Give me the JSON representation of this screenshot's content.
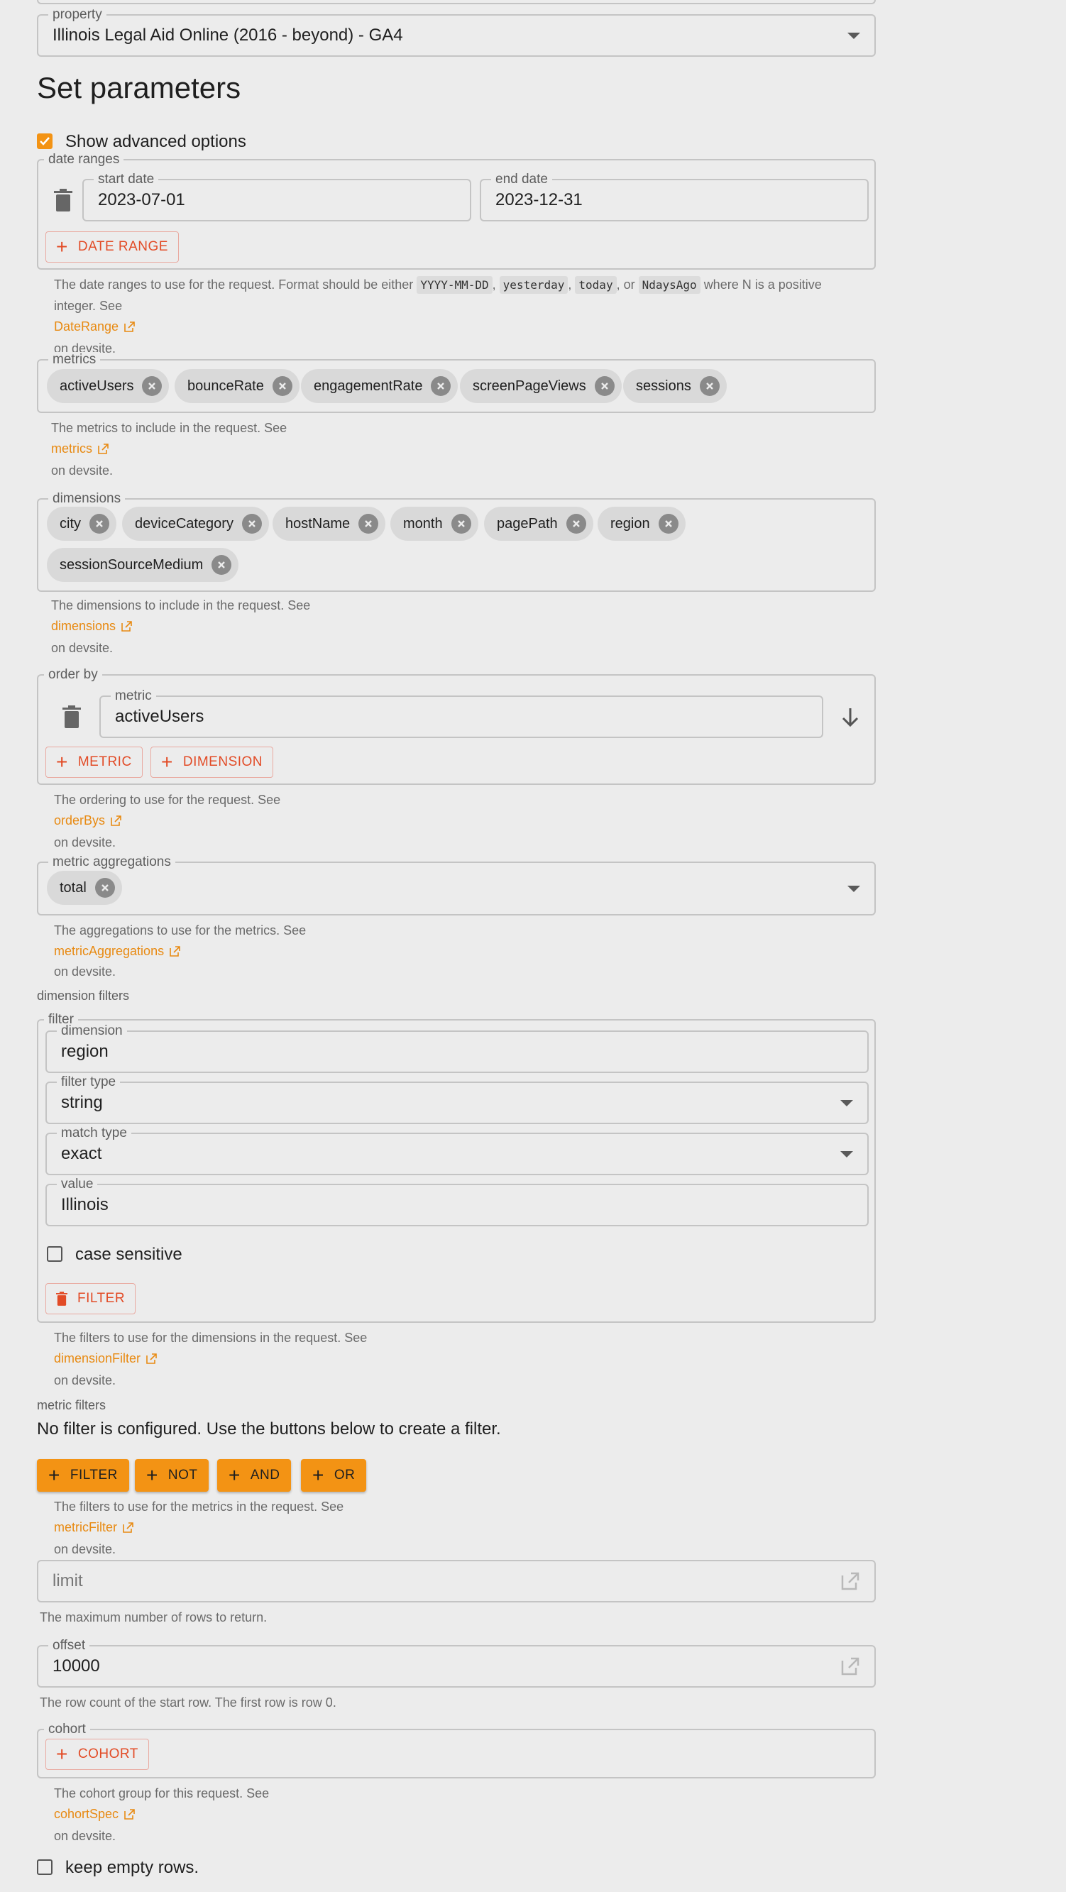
{
  "property": {
    "legend": "property",
    "value": "Illinois Legal Aid Online (2016 - beyond) - GA4"
  },
  "heading": "Set parameters",
  "advanced": {
    "label": "Show advanced options",
    "checked": true
  },
  "date_ranges": {
    "legend": "date ranges",
    "start_legend": "start date",
    "start_value": "2023-07-01",
    "end_legend": "end date",
    "end_value": "2023-12-31",
    "add_button": "DATE RANGE",
    "help_pre": "The date ranges to use for the request. Format should be either",
    "code_1": "YYYY-MM-DD",
    "sep_1": ",",
    "code_2": "yesterday",
    "sep_2": ",",
    "code_3": "today",
    "sep_3": ", or",
    "code_4": "NdaysAgo",
    "help_post": "where N is a positive",
    "help_line2": "integer. See",
    "link": "DateRange",
    "help_tail": "on devsite."
  },
  "metrics": {
    "legend": "metrics",
    "chips": [
      "activeUsers",
      "bounceRate",
      "engagementRate",
      "screenPageViews",
      "sessions"
    ],
    "help": "The metrics to include in the request. See",
    "link": "metrics",
    "help_tail": "on devsite."
  },
  "dimensions": {
    "legend": "dimensions",
    "chips": [
      "city",
      "deviceCategory",
      "hostName",
      "month",
      "pagePath",
      "region",
      "sessionSourceMedium"
    ],
    "help": "The dimensions to include in the request. See",
    "link": "dimensions",
    "help_tail": "on devsite."
  },
  "order_by": {
    "legend": "order by",
    "metric_legend": "metric",
    "metric_value": "activeUsers",
    "add_metric": "METRIC",
    "add_dimension": "DIMENSION",
    "help": "The ordering to use for the request. See",
    "link": "orderBys",
    "help_tail": "on devsite."
  },
  "metric_aggregations": {
    "legend": "metric aggregations",
    "chips": [
      "total"
    ],
    "help": "The aggregations to use for the metrics. See",
    "link": "metricAggregations",
    "help_tail": "on devsite."
  },
  "dimension_filters": {
    "label": "dimension filters",
    "filter_legend": "filter",
    "dimension_legend": "dimension",
    "dimension_value": "region",
    "filter_type_legend": "filter type",
    "filter_type_value": "string",
    "match_type_legend": "match type",
    "match_type_value": "exact",
    "value_legend": "value",
    "value_value": "Illinois",
    "case_sensitive": "case sensitive",
    "case_checked": false,
    "remove_button": "FILTER",
    "help": "The filters to use for the dimensions in the request. See",
    "link": "dimensionFilter",
    "help_tail": "on devsite."
  },
  "metric_filters": {
    "label": "metric filters",
    "empty": "No filter is configured. Use the buttons below to create a filter.",
    "buttons": [
      "FILTER",
      "NOT",
      "AND",
      "OR"
    ],
    "help": "The filters to use for the metrics in the request. See",
    "link": "metricFilter",
    "help_tail": "on devsite."
  },
  "limit": {
    "placeholder": "limit",
    "help": "The maximum number of rows to return."
  },
  "offset": {
    "legend": "offset",
    "value": "10000",
    "help": "The row count of the start row. The first row is row 0."
  },
  "cohort": {
    "legend": "cohort",
    "add_button": "COHORT",
    "help": "The cohort group for this request. See",
    "link": "cohortSpec",
    "help_tail": "on devsite."
  },
  "keep_empty": {
    "label": "keep empty rows.",
    "checked": false
  },
  "colors": {
    "accent": "#f39314",
    "danger": "#e24b26",
    "link": "#e88a12"
  }
}
